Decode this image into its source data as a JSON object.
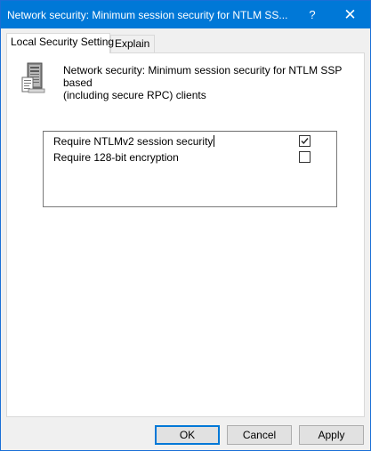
{
  "window": {
    "title": "Network security: Minimum session security for NTLM SS...",
    "help_label": "?",
    "close_label": "✕"
  },
  "tabs": [
    {
      "label": "Local Security Setting",
      "active": true
    },
    {
      "label": "Explain",
      "active": false
    }
  ],
  "policy": {
    "icon": "server-policy-icon",
    "description_line1": "Network security: Minimum session security for NTLM SSP based",
    "description_line2": "(including secure RPC) clients"
  },
  "options": [
    {
      "label": "Require NTLMv2 session security",
      "checked": true
    },
    {
      "label": "Require 128-bit encryption",
      "checked": false
    }
  ],
  "buttons": {
    "ok": "OK",
    "cancel": "Cancel",
    "apply": "Apply"
  },
  "colors": {
    "titlebar": "#0078d7",
    "accent": "#0078d7"
  }
}
